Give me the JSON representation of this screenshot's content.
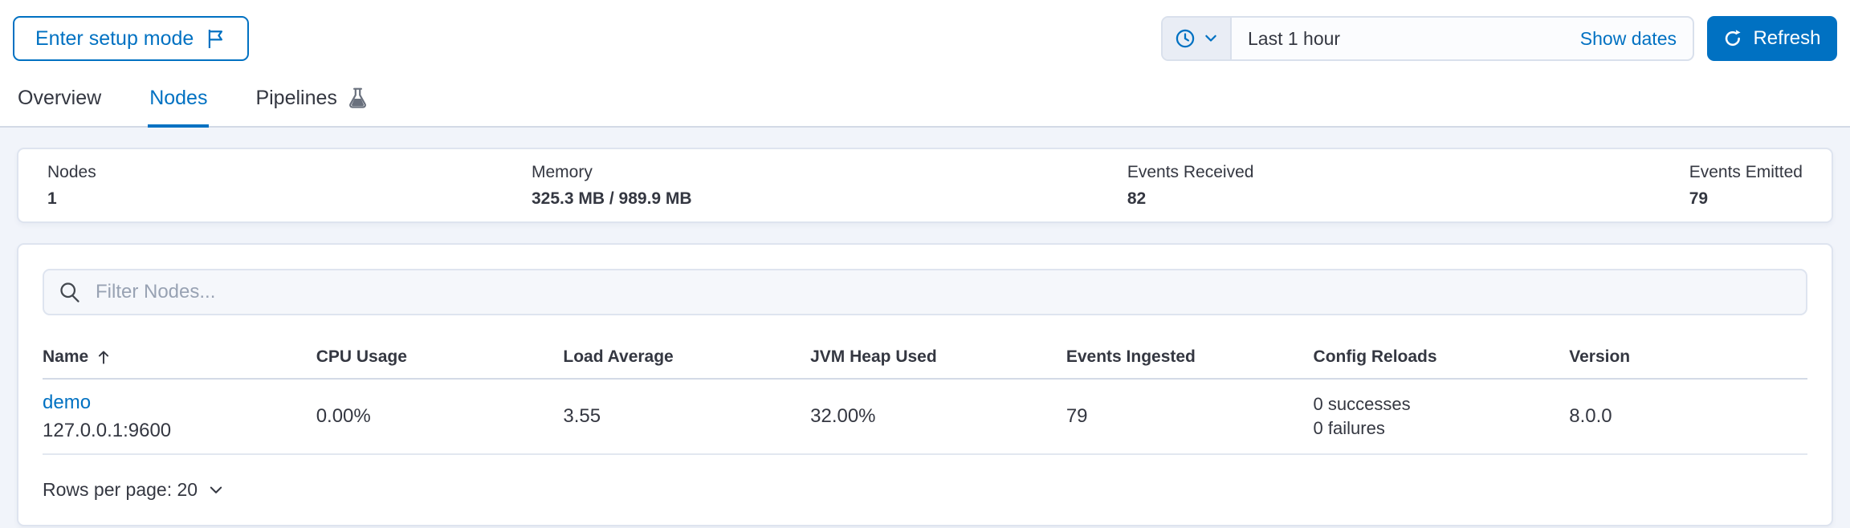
{
  "header": {
    "setup_button_label": "Enter setup mode",
    "time_picker": {
      "range_label": "Last 1 hour",
      "show_dates_label": "Show dates"
    },
    "refresh_button_label": "Refresh"
  },
  "tabs": [
    {
      "label": "Overview",
      "active": false
    },
    {
      "label": "Nodes",
      "active": true
    },
    {
      "label": "Pipelines",
      "active": false
    }
  ],
  "summary": {
    "stats": [
      {
        "label": "Nodes",
        "value": "1"
      },
      {
        "label": "Memory",
        "value": "325.3 MB / 989.9 MB"
      },
      {
        "label": "Events Received",
        "value": "82"
      },
      {
        "label": "Events Emitted",
        "value": "79"
      }
    ]
  },
  "nodes_panel": {
    "filter_placeholder": "Filter Nodes...",
    "table": {
      "columns": [
        "Name",
        "CPU Usage",
        "Load Average",
        "JVM Heap Used",
        "Events Ingested",
        "Config Reloads",
        "Version"
      ],
      "sort_column": "Name",
      "sort_direction": "ascending",
      "rows": [
        {
          "name": "demo",
          "transport_address": "127.0.0.1:9600",
          "cpu_usage": "0.00%",
          "load_average": "3.55",
          "jvm_heap_used": "32.00%",
          "events_ingested": "79",
          "config_reloads_successes": "0 successes",
          "config_reloads_failures": "0 failures",
          "version": "8.0.0"
        }
      ]
    },
    "pagination": {
      "rows_per_page_label": "Rows per page: 20"
    }
  },
  "icons": {
    "setup": "flag-icon",
    "quick_select": "clock-icon",
    "refresh": "refresh-icon",
    "pipelines_tab": "beaker-icon",
    "filter": "search-icon",
    "sort": "arrow-up-icon",
    "pagination": "chevron-down-icon"
  },
  "colors": {
    "primary": "#0071c2",
    "text": "#343741",
    "subdued": "#69707d",
    "placeholder": "#98a2b3",
    "border": "#d3dae6",
    "page_background": "#f1f4fa",
    "panel_background": "#ffffff"
  }
}
